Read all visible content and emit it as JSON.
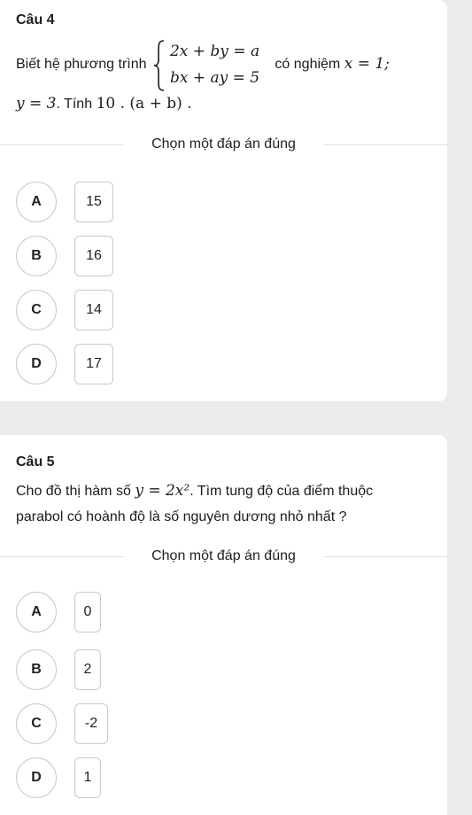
{
  "questions": [
    {
      "number": "Câu 4",
      "text_prefix": "Biết hệ phương trình",
      "system_eq1": "2x + by = a",
      "system_eq2": "bx + ay = 5",
      "text_mid": "có nghiệm",
      "text_x": "x = 1;",
      "line2_y": "y = 3",
      "line2_rest": ". Tính",
      "line2_expr": "10 . (a + b) .",
      "choose_label": "Chọn một đáp án đúng",
      "options": [
        {
          "letter": "A",
          "value": "15"
        },
        {
          "letter": "B",
          "value": "16"
        },
        {
          "letter": "C",
          "value": "14"
        },
        {
          "letter": "D",
          "value": "17"
        }
      ]
    },
    {
      "number": "Câu 5",
      "line1_prefix": "Cho đồ thị hàm số",
      "line1_func": "y = 2x²",
      "line1_suffix": ". Tìm tung độ của điểm thuộc",
      "line2": "parabol có hoành độ là số nguyên dương nhỏ nhất ?",
      "choose_label": "Chọn một đáp án đúng",
      "options": [
        {
          "letter": "A",
          "value": "0"
        },
        {
          "letter": "B",
          "value": "2"
        },
        {
          "letter": "C",
          "value": "-2"
        },
        {
          "letter": "D",
          "value": "1"
        }
      ]
    }
  ]
}
